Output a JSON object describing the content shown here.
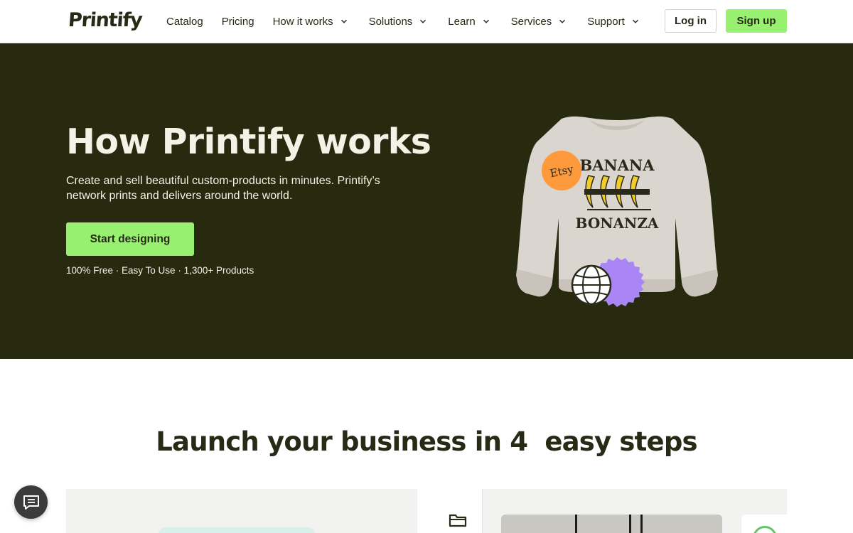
{
  "header": {
    "logo": "Printify",
    "nav": [
      {
        "label": "Catalog",
        "dropdown": false
      },
      {
        "label": "Pricing",
        "dropdown": false
      },
      {
        "label": "How it works",
        "dropdown": true
      },
      {
        "label": "Solutions",
        "dropdown": true
      },
      {
        "label": "Learn",
        "dropdown": true
      },
      {
        "label": "Services",
        "dropdown": true
      },
      {
        "label": "Support",
        "dropdown": true
      }
    ],
    "login_label": "Log in",
    "signup_label": "Sign up"
  },
  "hero": {
    "title": "How Printify works",
    "subtitle": "Create and sell beautiful custom-products in minutes. Printify’s network prints and delivers around the world.",
    "cta_label": "Start designing",
    "features": "100% Free · Easy To Use · 1,300+ Products",
    "artwork": {
      "badge_text": "Etsy",
      "shirt_text_top": "BANANA",
      "shirt_text_bottom": "BONANZA",
      "globe_icon": "globe-icon"
    }
  },
  "steps": {
    "title": "Launch your business in 4  easy steps"
  },
  "icons": {
    "folder": "folder-icon",
    "chat": "chat-icon",
    "chevron": "chevron-down-icon"
  },
  "colors": {
    "brand_dark": "#272a0e",
    "accent_green": "#97f06f",
    "cream": "#f4f1e6",
    "badge_orange": "#ff9a3c",
    "badge_purple": "#a985f5"
  }
}
